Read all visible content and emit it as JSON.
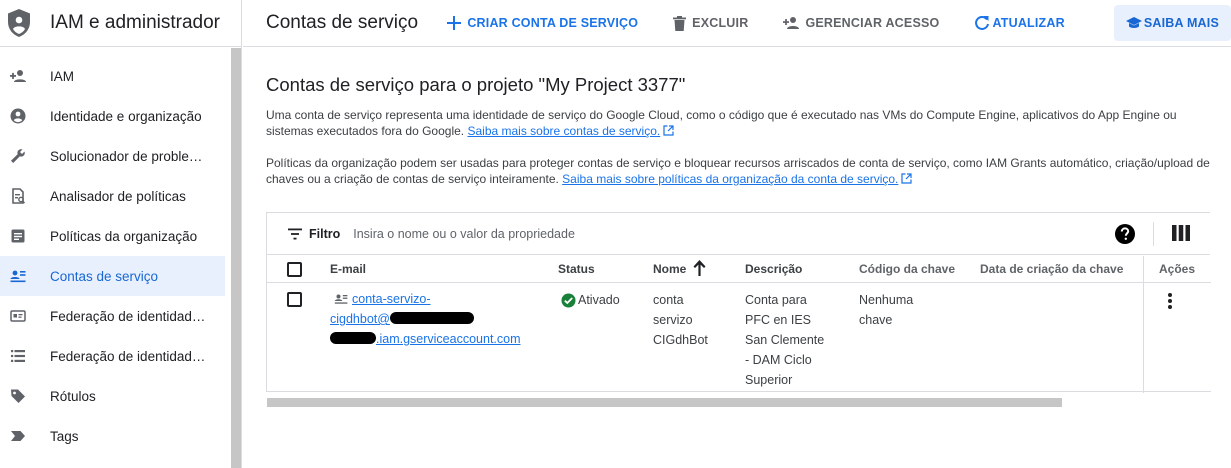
{
  "sidebar": {
    "title": "IAM e administrador",
    "items": [
      {
        "label": "IAM",
        "icon": "person-add-icon",
        "active": false
      },
      {
        "label": "Identidade e organização",
        "icon": "account-circle-icon",
        "active": false
      },
      {
        "label": "Solucionador de problem…",
        "icon": "wrench-icon",
        "active": false
      },
      {
        "label": "Analisador de políticas",
        "icon": "policy-doc-icon",
        "active": false
      },
      {
        "label": "Políticas da organização",
        "icon": "article-icon",
        "active": false
      },
      {
        "label": "Contas de serviço",
        "icon": "service-account-icon",
        "active": true
      },
      {
        "label": "Federação de identidade …",
        "icon": "id-card-icon",
        "active": false
      },
      {
        "label": "Federação de identidade …",
        "icon": "list-icon",
        "active": false
      },
      {
        "label": "Rótulos",
        "icon": "label-icon",
        "active": false
      },
      {
        "label": "Tags",
        "icon": "tag-icon",
        "active": false
      }
    ]
  },
  "toolbar": {
    "page_title": "Contas de serviço",
    "create_label": "CRIAR CONTA DE SERVIÇO",
    "delete_label": "EXCLUIR",
    "manage_label": "GERENCIAR ACESSO",
    "refresh_label": "ATUALIZAR",
    "learn_label": "SAIBA MAIS"
  },
  "main": {
    "heading": "Contas de serviço para o projeto \"My Project 3377\"",
    "para1": "Uma conta de serviço representa uma identidade de serviço do Google Cloud, como o código que é executado nas VMs do Compute Engine, aplicativos do App Engine ou sistemas executados fora do Google.",
    "para1_link": "Saiba mais sobre contas de serviço.",
    "para2": "Políticas da organização podem ser usadas para proteger contas de serviço e bloquear recursos arriscados de conta de serviço, como IAM Grants automático, criação/upload de chaves ou a criação de contas de serviço inteiramente.",
    "para2_link": "Saiba mais sobre políticas da organização da conta de serviço."
  },
  "filter": {
    "label": "Filtro",
    "placeholder": "Insira o nome ou o valor da propriedade"
  },
  "table": {
    "columns": {
      "email": "E-mail",
      "status": "Status",
      "name": "Nome",
      "description": "Descrição",
      "key_id": "Código da chave",
      "key_date": "Data de criação da chave",
      "actions": "Ações"
    },
    "sort": {
      "column": "name",
      "direction": "ascending"
    },
    "rows": [
      {
        "email_line1": "conta-servizo-",
        "email_line2": "cigdhbot@",
        "email_line3": ".iam.gserviceaccount.com",
        "status": "Ativado",
        "name_lines": [
          "conta",
          "servizo",
          "CIGdhBot"
        ],
        "description_lines": [
          "Conta para",
          "PFC en IES",
          "San Clemente",
          "- DAM Ciclo",
          "Superior"
        ],
        "key_lines": [
          "Nenhuma",
          "chave"
        ],
        "key_date": ""
      }
    ]
  },
  "colors": {
    "accent": "#1a73e8",
    "active_bg": "#e8f0fe",
    "success": "#188038"
  }
}
